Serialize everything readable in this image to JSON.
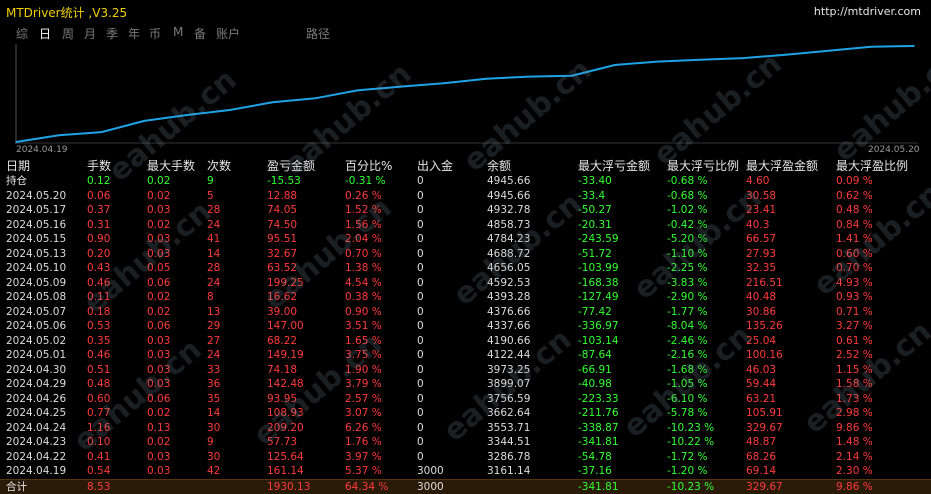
{
  "app": {
    "title": "MTDriver统计 ,V3.25",
    "url": "http://mtdriver.com"
  },
  "tabs": [
    {
      "label": "综",
      "active": false
    },
    {
      "label": "日",
      "active": true
    },
    {
      "label": "周",
      "active": false
    },
    {
      "label": "月",
      "active": false
    },
    {
      "label": "季",
      "active": false
    },
    {
      "label": "年",
      "active": false
    },
    {
      "label": "币",
      "active": false
    },
    {
      "label": "M",
      "active": false
    },
    {
      "label": "备",
      "active": false
    },
    {
      "label": "账户",
      "active": false
    },
    {
      "label": "路径",
      "active": false
    }
  ],
  "chart_data": {
    "type": "line",
    "x_start": "2024.04.19",
    "x_end": "2024.05.20",
    "series": [
      {
        "color": "#1fa3e6",
        "x": [
          "2024.04.19",
          "2024.04.22",
          "2024.04.23",
          "2024.04.24",
          "2024.04.25",
          "2024.04.26",
          "2024.04.29",
          "2024.04.30",
          "2024.05.01",
          "2024.05.02",
          "2024.05.03",
          "2024.05.06",
          "2024.05.07",
          "2024.05.08",
          "2024.05.09",
          "2024.05.10",
          "2024.05.13",
          "2024.05.14",
          "2024.05.15",
          "2024.05.16",
          "2024.05.17",
          "2024.05.20"
        ],
        "values": [
          3161.14,
          3286.78,
          3344.51,
          3553.71,
          3662.64,
          3756.59,
          3899.07,
          3973.25,
          4122.44,
          4190.66,
          4254.0,
          4337.66,
          4376.66,
          4393.28,
          4592.53,
          4656.05,
          4688.72,
          4720.0,
          4784.23,
          4858.73,
          4932.78,
          4945.66
        ]
      }
    ]
  },
  "table": {
    "headers": [
      "日期",
      "手数",
      "最大手数",
      "次数",
      "盈亏金额",
      "百分比%",
      "出入金",
      "余额",
      "最大浮亏金额",
      "最大浮亏比例",
      "最大浮盈金额",
      "最大浮盈比例"
    ],
    "position": {
      "date": "持仓",
      "lots": "0.12",
      "max_lots": "0.02",
      "count": "9",
      "pl": "-15.53",
      "pct": "-0.31 %",
      "inout": "0",
      "balance": "4945.66",
      "max_float_loss": "-33.40",
      "max_float_loss_pct": "-0.68 %",
      "max_float_profit": "4.60",
      "max_float_profit_pct": "0.09 %"
    },
    "rows": [
      {
        "date": "2024.05.20",
        "lots": "0.06",
        "max_lots": "0.02",
        "count": "5",
        "pl": "12.88",
        "pct": "0.26 %",
        "inout": "0",
        "balance": "4945.66",
        "max_float_loss": "-33.4",
        "max_float_loss_pct": "-0.68 %",
        "max_float_profit": "30.58",
        "max_float_profit_pct": "0.62 %"
      },
      {
        "date": "2024.05.17",
        "lots": "0.37",
        "max_lots": "0.03",
        "count": "28",
        "pl": "74.05",
        "pct": "1.52 %",
        "inout": "0",
        "balance": "4932.78",
        "max_float_loss": "-50.27",
        "max_float_loss_pct": "-1.02 %",
        "max_float_profit": "23.41",
        "max_float_profit_pct": "0.48 %"
      },
      {
        "date": "2024.05.16",
        "lots": "0.31",
        "max_lots": "0.02",
        "count": "24",
        "pl": "74.50",
        "pct": "1.56 %",
        "inout": "0",
        "balance": "4858.73",
        "max_float_loss": "-20.31",
        "max_float_loss_pct": "-0.42 %",
        "max_float_profit": "40.3",
        "max_float_profit_pct": "0.84 %"
      },
      {
        "date": "2024.05.15",
        "lots": "0.90",
        "max_lots": "0.03",
        "count": "41",
        "pl": "95.51",
        "pct": "2.04 %",
        "inout": "0",
        "balance": "4784.23",
        "max_float_loss": "-243.59",
        "max_float_loss_pct": "-5.20 %",
        "max_float_profit": "66.57",
        "max_float_profit_pct": "1.41 %"
      },
      {
        "date": "2024.05.13",
        "lots": "0.20",
        "max_lots": "0.03",
        "count": "14",
        "pl": "32.67",
        "pct": "0.70 %",
        "inout": "0",
        "balance": "4688.72",
        "max_float_loss": "-51.72",
        "max_float_loss_pct": "-1.10 %",
        "max_float_profit": "27.93",
        "max_float_profit_pct": "0.60 %"
      },
      {
        "date": "2024.05.10",
        "lots": "0.43",
        "max_lots": "0.05",
        "count": "28",
        "pl": "63.52",
        "pct": "1.38 %",
        "inout": "0",
        "balance": "4656.05",
        "max_float_loss": "-103.99",
        "max_float_loss_pct": "-2.25 %",
        "max_float_profit": "32.35",
        "max_float_profit_pct": "0.70 %"
      },
      {
        "date": "2024.05.09",
        "lots": "0.46",
        "max_lots": "0.06",
        "count": "24",
        "pl": "199.25",
        "pct": "4.54 %",
        "inout": "0",
        "balance": "4592.53",
        "max_float_loss": "-168.38",
        "max_float_loss_pct": "-3.83 %",
        "max_float_profit": "216.51",
        "max_float_profit_pct": "4.93 %"
      },
      {
        "date": "2024.05.08",
        "lots": "0.11",
        "max_lots": "0.02",
        "count": "8",
        "pl": "16.62",
        "pct": "0.38 %",
        "inout": "0",
        "balance": "4393.28",
        "max_float_loss": "-127.49",
        "max_float_loss_pct": "-2.90 %",
        "max_float_profit": "40.48",
        "max_float_profit_pct": "0.93 %"
      },
      {
        "date": "2024.05.07",
        "lots": "0.18",
        "max_lots": "0.02",
        "count": "13",
        "pl": "39.00",
        "pct": "0.90 %",
        "inout": "0",
        "balance": "4376.66",
        "max_float_loss": "-77.42",
        "max_float_loss_pct": "-1.77 %",
        "max_float_profit": "30.86",
        "max_float_profit_pct": "0.71 %"
      },
      {
        "date": "2024.05.06",
        "lots": "0.53",
        "max_lots": "0.06",
        "count": "29",
        "pl": "147.00",
        "pct": "3.51 %",
        "inout": "0",
        "balance": "4337.66",
        "max_float_loss": "-336.97",
        "max_float_loss_pct": "-8.04 %",
        "max_float_profit": "135.26",
        "max_float_profit_pct": "3.27 %"
      },
      {
        "date": "2024.05.02",
        "lots": "0.35",
        "max_lots": "0.03",
        "count": "27",
        "pl": "68.22",
        "pct": "1.65 %",
        "inout": "0",
        "balance": "4190.66",
        "max_float_loss": "-103.14",
        "max_float_loss_pct": "-2.46 %",
        "max_float_profit": "25.04",
        "max_float_profit_pct": "0.61 %"
      },
      {
        "date": "2024.05.01",
        "lots": "0.46",
        "max_lots": "0.03",
        "count": "24",
        "pl": "149.19",
        "pct": "3.75 %",
        "inout": "0",
        "balance": "4122.44",
        "max_float_loss": "-87.64",
        "max_float_loss_pct": "-2.16 %",
        "max_float_profit": "100.16",
        "max_float_profit_pct": "2.52 %"
      },
      {
        "date": "2024.04.30",
        "lots": "0.51",
        "max_lots": "0.03",
        "count": "33",
        "pl": "74.18",
        "pct": "1.90 %",
        "inout": "0",
        "balance": "3973.25",
        "max_float_loss": "-66.91",
        "max_float_loss_pct": "-1.68 %",
        "max_float_profit": "46.03",
        "max_float_profit_pct": "1.15 %"
      },
      {
        "date": "2024.04.29",
        "lots": "0.48",
        "max_lots": "0.03",
        "count": "36",
        "pl": "142.48",
        "pct": "3.79 %",
        "inout": "0",
        "balance": "3899.07",
        "max_float_loss": "-40.98",
        "max_float_loss_pct": "-1.05 %",
        "max_float_profit": "59.44",
        "max_float_profit_pct": "1.58 %"
      },
      {
        "date": "2024.04.26",
        "lots": "0.60",
        "max_lots": "0.06",
        "count": "35",
        "pl": "93.95",
        "pct": "2.57 %",
        "inout": "0",
        "balance": "3756.59",
        "max_float_loss": "-223.33",
        "max_float_loss_pct": "-6.10 %",
        "max_float_profit": "63.21",
        "max_float_profit_pct": "1.73 %"
      },
      {
        "date": "2024.04.25",
        "lots": "0.77",
        "max_lots": "0.02",
        "count": "14",
        "pl": "108.93",
        "pct": "3.07 %",
        "inout": "0",
        "balance": "3662.64",
        "max_float_loss": "-211.76",
        "max_float_loss_pct": "-5.78 %",
        "max_float_profit": "105.91",
        "max_float_profit_pct": "2.98 %"
      },
      {
        "date": "2024.04.24",
        "lots": "1.16",
        "max_lots": "0.13",
        "count": "30",
        "pl": "209.20",
        "pct": "6.26 %",
        "inout": "0",
        "balance": "3553.71",
        "max_float_loss": "-338.87",
        "max_float_loss_pct": "-10.23 %",
        "max_float_profit": "329.67",
        "max_float_profit_pct": "9.86 %"
      },
      {
        "date": "2024.04.23",
        "lots": "0.10",
        "max_lots": "0.02",
        "count": "9",
        "pl": "57.73",
        "pct": "1.76 %",
        "inout": "0",
        "balance": "3344.51",
        "max_float_loss": "-341.81",
        "max_float_loss_pct": "-10.22 %",
        "max_float_profit": "48.87",
        "max_float_profit_pct": "1.48 %"
      },
      {
        "date": "2024.04.22",
        "lots": "0.41",
        "max_lots": "0.03",
        "count": "30",
        "pl": "125.64",
        "pct": "3.97 %",
        "inout": "0",
        "balance": "3286.78",
        "max_float_loss": "-54.78",
        "max_float_loss_pct": "-1.72 %",
        "max_float_profit": "68.26",
        "max_float_profit_pct": "2.14 %"
      },
      {
        "date": "2024.04.19",
        "lots": "0.54",
        "max_lots": "0.03",
        "count": "42",
        "pl": "161.14",
        "pct": "5.37 %",
        "inout": "3000",
        "balance": "3161.14",
        "max_float_loss": "-37.16",
        "max_float_loss_pct": "-1.20 %",
        "max_float_profit": "69.14",
        "max_float_profit_pct": "2.30 %"
      }
    ],
    "total": {
      "date": "合计",
      "lots": "8.53",
      "max_lots": "",
      "count": "",
      "pl": "1930.13",
      "pct": "64.34 %",
      "inout": "3000",
      "balance": "",
      "max_float_loss": "-341.81",
      "max_float_loss_pct": "-10.23 %",
      "max_float_profit": "329.67",
      "max_float_profit_pct": "9.86 %"
    }
  },
  "watermark": "eahub.cn",
  "colors": {
    "positive": "#32ff32",
    "negative": "#ff3b3b",
    "accent": "#f0d000",
    "line": "#1fa3e6"
  }
}
